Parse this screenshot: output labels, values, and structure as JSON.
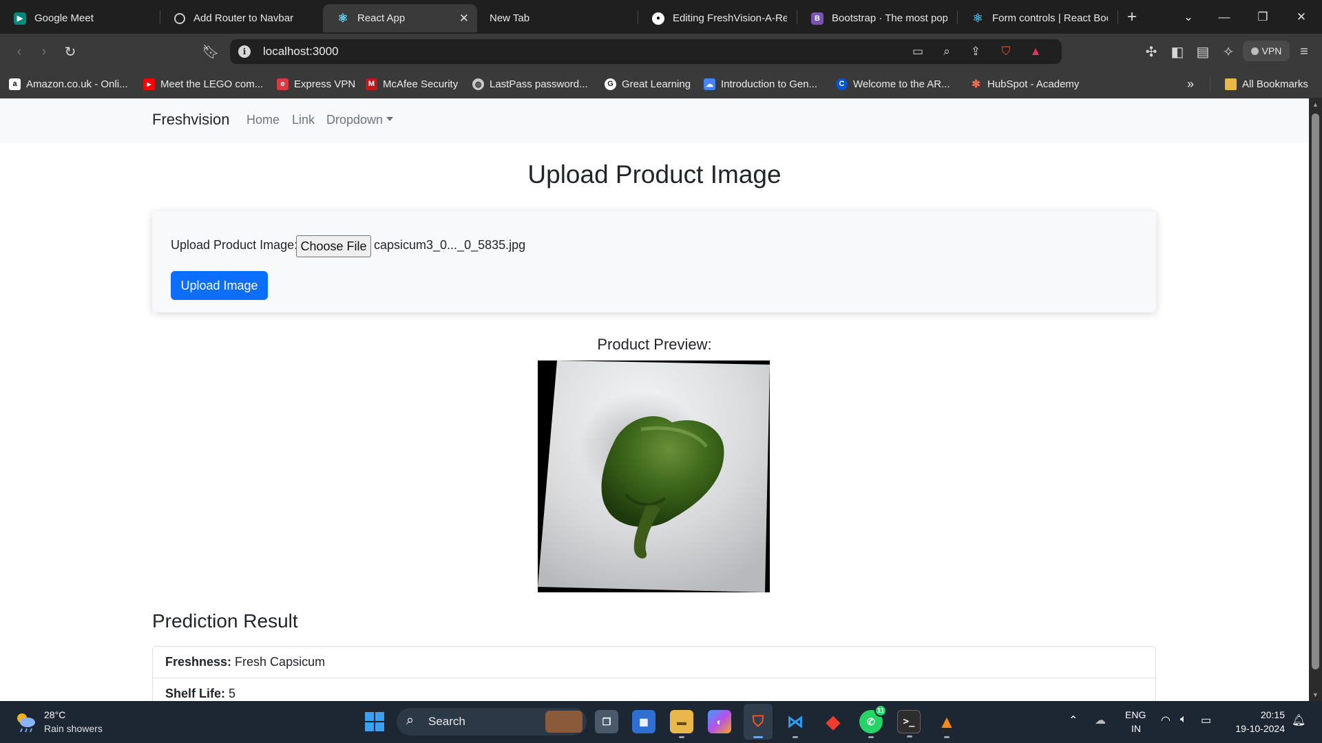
{
  "browser": {
    "tabs": [
      {
        "title": "Google Meet",
        "icon": "google-meet-icon",
        "color": "#00897b"
      },
      {
        "title": "Add Router to Navbar",
        "icon": "openai-icon",
        "color": "#555555"
      },
      {
        "title": "React App",
        "icon": "react-icon",
        "color": "#61dafb",
        "active": true
      },
      {
        "title": "New Tab",
        "icon": "",
        "color": ""
      },
      {
        "title": "Editing FreshVision-A-Re",
        "icon": "github-icon",
        "color": "#ffffff"
      },
      {
        "title": "Bootstrap · The most pop",
        "icon": "bootstrap-icon",
        "color": "#7952b3"
      },
      {
        "title": "Form controls | React Boo",
        "icon": "react-bootstrap-icon",
        "color": "#41a8d6"
      }
    ],
    "url": "localhost:3000",
    "vpn_label": "VPN",
    "bookmarks": [
      {
        "label": "Amazon.co.uk - Onli...",
        "icon": "amazon-icon",
        "color": "#ffffff"
      },
      {
        "label": "Meet the LEGO com...",
        "icon": "youtube-icon",
        "color": "#ff0000"
      },
      {
        "label": "Express VPN",
        "icon": "expressvpn-icon",
        "color": "#da3940"
      },
      {
        "label": "McAfee Security",
        "icon": "mcafee-icon",
        "color": "#c01818"
      },
      {
        "label": "LastPass password...",
        "icon": "globe-icon",
        "color": "#c8c8c8"
      },
      {
        "label": "Great Learning",
        "icon": "great-learning-icon",
        "color": "#ffffff"
      },
      {
        "label": "Introduction to Gen...",
        "icon": "google-cloud-icon",
        "color": "#4285f4"
      },
      {
        "label": "Welcome to the AR...",
        "icon": "coursera-icon",
        "color": "#0056d2"
      },
      {
        "label": "HubSpot - Academy",
        "icon": "hubspot-icon",
        "color": "#ff7a59"
      }
    ],
    "all_bookmarks": "All Bookmarks"
  },
  "app": {
    "brand": "Freshvision",
    "nav": {
      "home": "Home",
      "link": "Link",
      "dropdown": "Dropdown"
    },
    "page_title": "Upload Product Image",
    "form": {
      "label": "Upload Product Image:",
      "choose_file": "Choose File",
      "file_name": "capsicum3_0..._0_5835.jpg",
      "submit": "Upload Image"
    },
    "preview_title": "Product Preview:",
    "result": {
      "title": "Prediction Result",
      "freshness_label": "Freshness:",
      "freshness_value": "Fresh Capsicum",
      "shelf_life_label": "Shelf Life:",
      "shelf_life_value": "5"
    },
    "colors": {
      "primary": "#0d6efd",
      "navbar_bg": "#f8f9fa"
    }
  },
  "taskbar": {
    "weather_temp": "28°C",
    "weather_desc": "Rain showers",
    "search_placeholder": "Search",
    "whatsapp_badge": "11",
    "lang_top": "ENG",
    "lang_bottom": "IN",
    "time": "20:15",
    "date": "19-10-2024"
  }
}
